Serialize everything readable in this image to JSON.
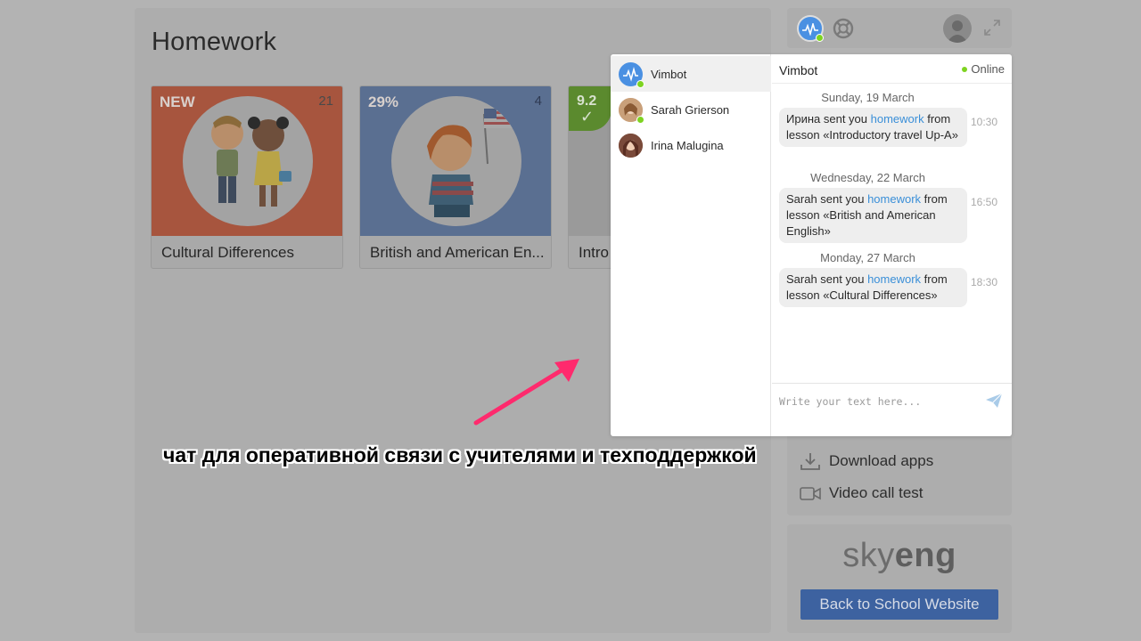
{
  "homework": {
    "title": "Homework",
    "cards": [
      {
        "badge": "NEW",
        "count": "21",
        "title": "Cultural Differences"
      },
      {
        "badge": "29%",
        "count": "4",
        "title": "British and American En..."
      },
      {
        "score": "9.2",
        "title": "Intro"
      }
    ]
  },
  "annotation": {
    "caption": "чат для оперативной связи с учителями и техподдержкой"
  },
  "sidebar": {
    "menu": [
      {
        "label": "Download apps",
        "icon": "download-icon"
      },
      {
        "label": "Video call test",
        "icon": "video-camera-icon"
      }
    ],
    "brand": {
      "logo_light": "sky",
      "logo_bold": "eng"
    },
    "back_button": "Back to School Website"
  },
  "chat": {
    "contacts": [
      {
        "name": "Vimbot"
      },
      {
        "name": "Sarah Grierson"
      },
      {
        "name": "Irina Malugina"
      }
    ],
    "header": {
      "name": "Vimbot",
      "status": "Online"
    },
    "messages": [
      {
        "date": "Sunday, 19 March",
        "prefix": "Ирина sent you ",
        "link": "homework",
        "suffix": " from lesson «Introductory travel Up-A»",
        "time": "10:30"
      },
      {
        "date": "Wednesday, 22 March",
        "prefix": "Sarah sent you ",
        "link": "homework",
        "suffix": " from lesson «British and American English»",
        "time": "16:50"
      },
      {
        "date": "Monday, 27 March",
        "prefix": "Sarah sent you ",
        "link": "homework",
        "suffix": " from lesson «Cultural Differences»",
        "time": "18:30"
      }
    ],
    "input": {
      "value": "",
      "placeholder": "Write your text here..."
    }
  },
  "colors": {
    "accent": "#4a90e2",
    "online": "#7ed321",
    "link": "#3a8fd8",
    "annotation_arrow": "#ff2a6d"
  }
}
